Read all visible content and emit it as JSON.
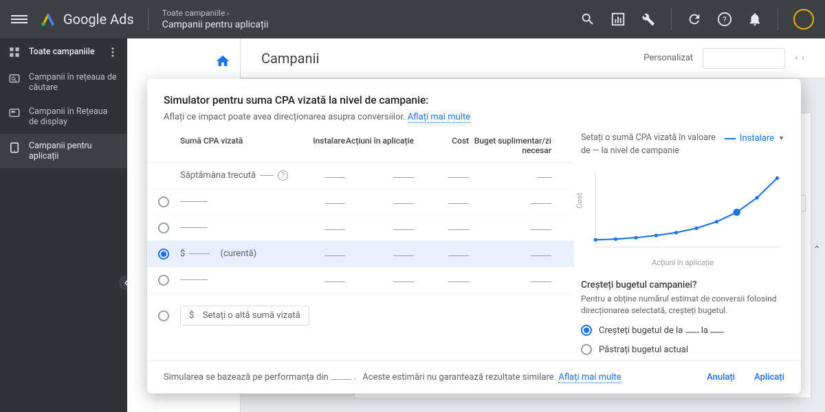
{
  "header": {
    "brand": "Google Ads",
    "breadcrumb_top": "Toate campaniile",
    "breadcrumb_sub": "Campanii pentru aplicații"
  },
  "sidebar": {
    "items": [
      {
        "label": "Toate campaniile"
      },
      {
        "label": "Campanii în rețeaua de căutare"
      },
      {
        "label": "Campanii în Rețeaua de display"
      },
      {
        "label": "Campanii pentru aplicații"
      }
    ]
  },
  "page": {
    "title": "Campanii",
    "customize": "Personalizat"
  },
  "modal": {
    "title": "Simulator pentru suma CPA vizată la nivel de campanie:",
    "subtitle_a": "Aflați ce impact poate avea direcționarea asupra conversiilor.",
    "learn_more": "Aflați mai multe",
    "columns": {
      "c1": "Sumă CPA vizată",
      "c2": "Instalare",
      "c3": "Acțiuni în aplicație",
      "c4": "Cost",
      "c5": "Buget suplimentar/zi necesar"
    },
    "last_week": "Săptămâna trecută",
    "current_suffix": "(curentă)",
    "set_other": "Setați o altă sumă vizată",
    "side": {
      "title_a": "Setați o sumă CPA vizată în valoare de",
      "title_b": "la nivel de campanie",
      "legend": "Instalare",
      "ylabel": "Cost",
      "xlabel": "Acțiuni în aplicație",
      "budget_q": "Creșteți bugetul campaniei?",
      "budget_sub": "Pentru a obține numărul estimat de conversii folosind direcționarea selectată, creșteți bugetul.",
      "opt1_a": "Creșteți bugetul de la",
      "opt1_b": "la",
      "opt2": "Păstrați bugetul actual"
    },
    "footer": {
      "text_a": "Simularea se bazează pe performanța din",
      "text_b": "Aceste estimări nu garantează rezultate similare.",
      "learn": "Aflați mai multe",
      "cancel": "Anulați",
      "apply": "Aplicați"
    }
  },
  "chart_data": {
    "type": "line",
    "title": "Instalare",
    "xlabel": "Acțiuni în aplicație",
    "ylabel": "Cost",
    "x": [
      1,
      2,
      3,
      4,
      5,
      6,
      7,
      8,
      9,
      10
    ],
    "y": [
      10,
      11,
      13,
      16,
      20,
      26,
      35,
      48,
      68,
      95
    ],
    "highlight_index": 7,
    "xlim": [
      1,
      10
    ],
    "ylim": [
      0,
      100
    ]
  }
}
